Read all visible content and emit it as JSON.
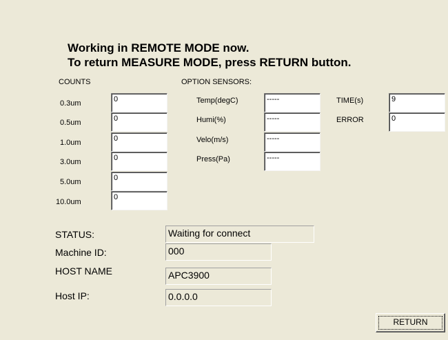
{
  "header": {
    "line1": "Working in REMOTE MODE now.",
    "line2": "To return MEASURE MODE, press RETURN button."
  },
  "counts": {
    "section_label": "COUNTS",
    "rows": [
      {
        "label": "0.3um",
        "value": "0"
      },
      {
        "label": "0.5um",
        "value": "0"
      },
      {
        "label": "1.0um",
        "value": "0"
      },
      {
        "label": "3.0um",
        "value": "0"
      },
      {
        "label": "5.0um",
        "value": "0"
      },
      {
        "label": "10.0um",
        "value": "0"
      }
    ]
  },
  "sensors": {
    "section_label": "OPTION SENSORS:",
    "rows": [
      {
        "label": "Temp(degC)",
        "value": "-----"
      },
      {
        "label": "Humi(%)",
        "value": "-----"
      },
      {
        "label": "Velo(m/s)",
        "value": "-----"
      },
      {
        "label": "Press(Pa)",
        "value": "-----"
      }
    ]
  },
  "misc": {
    "time_label": "TIME(s)",
    "time_value": "9",
    "error_label": "ERROR",
    "error_value": "0"
  },
  "info": {
    "status_label": "STATUS:",
    "status_value": "Waiting for connect",
    "machine_id_label": "Machine ID:",
    "machine_id_value": "000",
    "host_name_label": "HOST NAME",
    "host_name_value": "APC3900",
    "host_ip_label": "Host IP:",
    "host_ip_value": "0.0.0.0"
  },
  "buttons": {
    "return_label": "RETURN"
  }
}
